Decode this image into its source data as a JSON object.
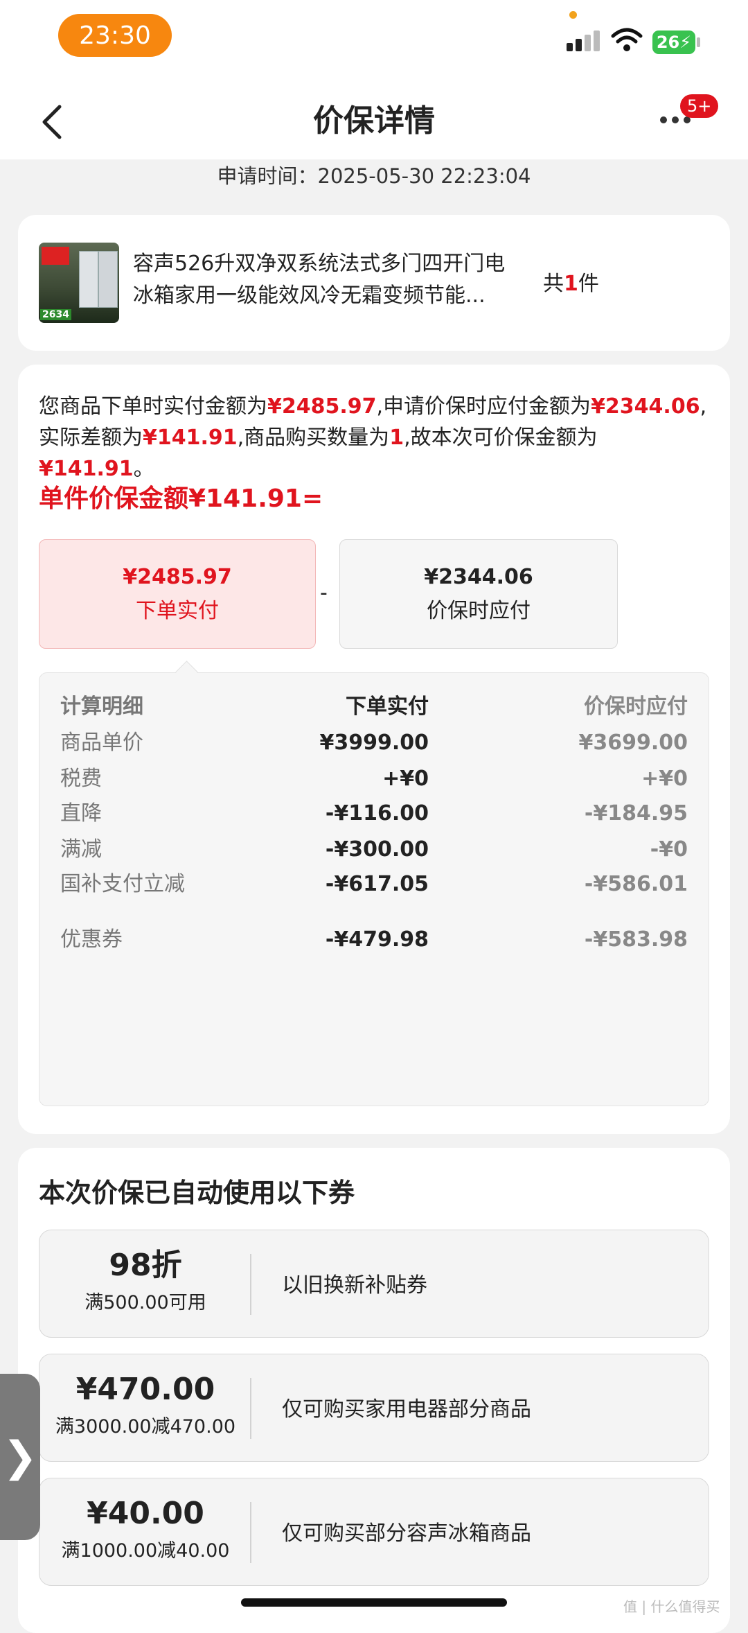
{
  "status_bar": {
    "time": "23:30",
    "battery": "26"
  },
  "nav": {
    "title": "价保详情",
    "badge": "5+"
  },
  "apply_time": "申请时间：2025-05-30 22:23:04",
  "product": {
    "title_line1": "容声526升双净双系统法式多门四开门电",
    "title_line2": "冰箱家用一级能效风冷无霜变频节能...",
    "image_tag": "2634",
    "count_prefix": "共",
    "count": "1",
    "count_suffix": "件"
  },
  "description": {
    "p1": "您商品下单时实付金额为",
    "v1": "¥2485.97",
    "p2": ",申请价保时应付金额为",
    "v2": "¥2344.06",
    "p3": ",实际差额为",
    "v3": "¥141.91",
    "p4": ",商品购买数量为",
    "v4": "1",
    "p5": ",故本次可价保金额为",
    "v5": "¥141.91",
    "p6": "。"
  },
  "unit_refund_title": "单件价保金额¥141.91=",
  "compare": {
    "minus": "-",
    "order": {
      "amount": "¥2485.97",
      "label": "下单实付"
    },
    "protect": {
      "amount": "¥2344.06",
      "label": "价保时应付"
    }
  },
  "calc_table": {
    "header": [
      "计算明细",
      "下单实付",
      "价保时应付"
    ],
    "rows": [
      {
        "label": "商品单价",
        "order": "¥3999.00",
        "protect": "¥3699.00"
      },
      {
        "label": "税费",
        "order": "+¥0",
        "protect": "+¥0"
      },
      {
        "label": "直降",
        "order": "-¥116.00",
        "protect": "-¥184.95"
      },
      {
        "label": "满减",
        "order": "-¥300.00",
        "protect": "-¥0"
      },
      {
        "label": "国补支付立减",
        "order": "-¥617.05",
        "protect": "-¥586.01"
      },
      {
        "label": "优惠券",
        "order": "-¥479.98",
        "protect": "-¥583.98"
      }
    ]
  },
  "coupons": {
    "title": "本次价保已自动使用以下券",
    "items": [
      {
        "amount": "98折",
        "condition": "满500.00可用",
        "name": "以旧换新补贴券"
      },
      {
        "amount": "¥470.00",
        "condition": "满3000.00减470.00",
        "name": "仅可购买家用电器部分商品"
      },
      {
        "amount": "¥40.00",
        "condition": "满1000.00减40.00",
        "name": "仅可购买部分容声冰箱商品"
      }
    ]
  },
  "side_handle": "❯",
  "watermark": "值 | 什么值得买"
}
